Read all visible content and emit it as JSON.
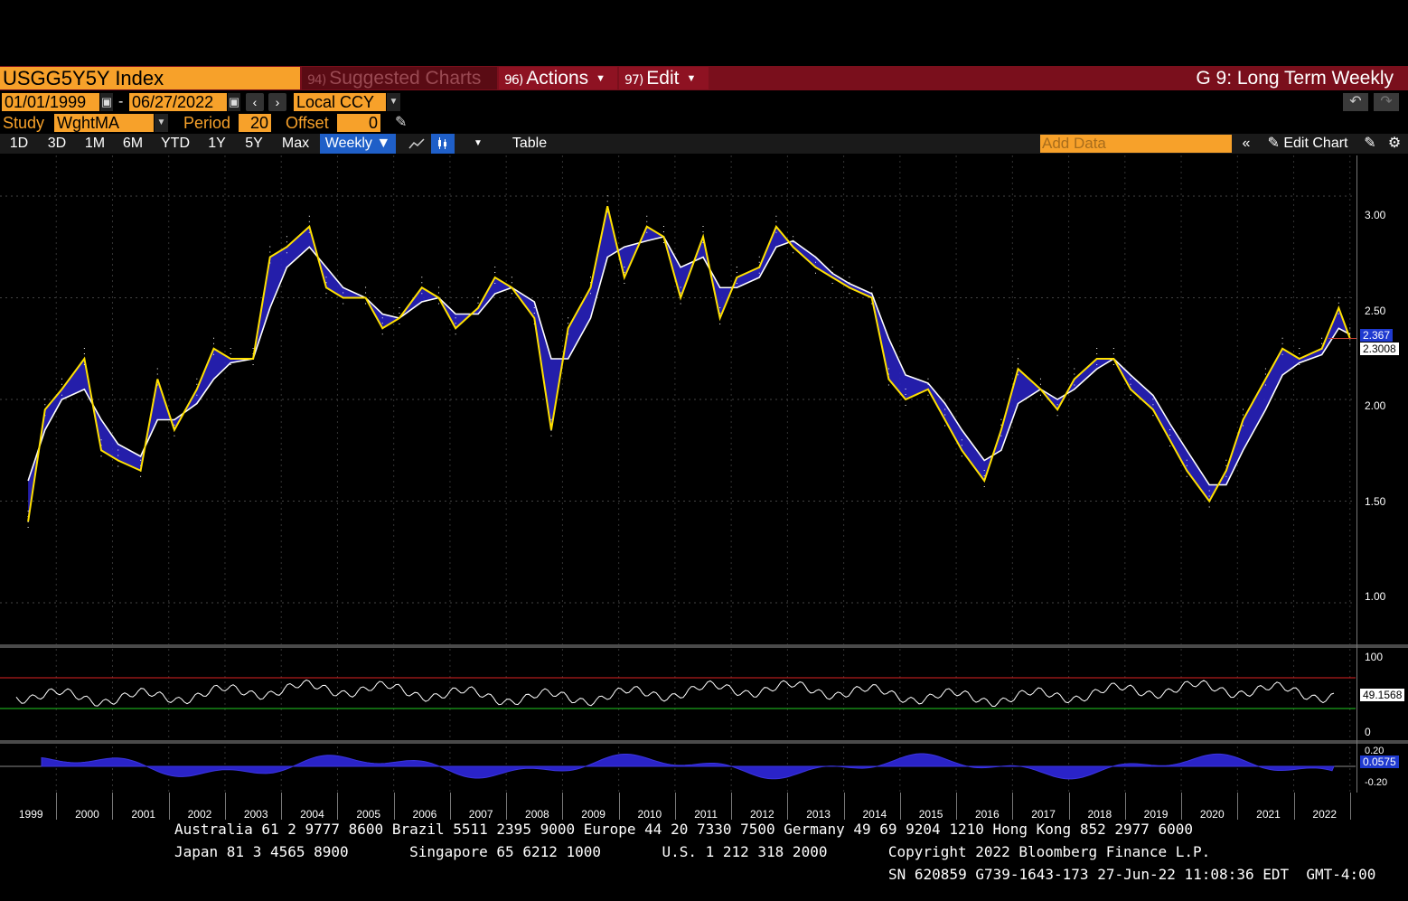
{
  "header": {
    "ticker": "USGG5Y5Y Index",
    "menus": [
      {
        "num": "94)",
        "label": "Suggested Charts"
      },
      {
        "num": "96)",
        "label": "Actions"
      },
      {
        "num": "97)",
        "label": "Edit"
      }
    ],
    "chart_title": "G 9: Long Term Weekly"
  },
  "range": {
    "start": "01/01/1999",
    "sep": "-",
    "end": "06/27/2022",
    "currency": "Local CCY"
  },
  "study": {
    "label": "Study",
    "value": "WghtMA",
    "period_label": "Period",
    "period": "20",
    "offset_label": "Offset",
    "offset": "0"
  },
  "toolbar": {
    "periods": [
      "1D",
      "3D",
      "1M",
      "6M",
      "YTD",
      "1Y",
      "5Y",
      "Max"
    ],
    "frequency": "Weekly ▼",
    "table": "Table",
    "add_data_placeholder": "Add Data",
    "edit_chart": "Edit Chart"
  },
  "main_axis": {
    "ticks": [
      "3.00",
      "2.50",
      "2.00",
      "1.50",
      "1.00"
    ],
    "last_price": "2.367",
    "ma_value": "2.3008"
  },
  "rsi_axis": {
    "ticks": [
      "100",
      "0"
    ],
    "value": "49.1568"
  },
  "macd_axis": {
    "ticks": [
      "0.20",
      "-0.20"
    ],
    "value": "0.0575"
  },
  "x_axis": [
    "1999",
    "2000",
    "2001",
    "2002",
    "2003",
    "2004",
    "2005",
    "2006",
    "2007",
    "2008",
    "2009",
    "2010",
    "2011",
    "2012",
    "2013",
    "2014",
    "2015",
    "2016",
    "2017",
    "2018",
    "2019",
    "2020",
    "2021",
    "2022"
  ],
  "footer": {
    "line1": "Australia 61 2 9777 8600 Brazil 5511 2395 9000 Europe 44 20 7330 7500 Germany 49 69 9204 1210 Hong Kong 852 2977 6000",
    "line2": "Japan 81 3 4565 8900       Singapore 65 6212 1000       U.S. 1 212 318 2000       Copyright 2022 Bloomberg Finance L.P.",
    "line3": "SN 620859 G739-1643-173 27-Jun-22 11:08:36 EDT  GMT-4:00"
  },
  "colors": {
    "orange": "#f7a12a",
    "ma_fast": "#ffe000",
    "ma_slow": "#ffffff",
    "fill": "#2a23c8",
    "bar_red": "#7a0f1c"
  },
  "chart_data": {
    "type": "line",
    "x": [
      1999.0,
      1999.3,
      1999.6,
      2000.0,
      2000.3,
      2000.6,
      2001.0,
      2001.3,
      2001.6,
      2002.0,
      2002.3,
      2002.6,
      2003.0,
      2003.3,
      2003.6,
      2004.0,
      2004.3,
      2004.6,
      2005.0,
      2005.3,
      2005.6,
      2006.0,
      2006.3,
      2006.6,
      2007.0,
      2007.3,
      2007.6,
      2008.0,
      2008.3,
      2008.6,
      2009.0,
      2009.3,
      2009.6,
      2010.0,
      2010.3,
      2010.6,
      2011.0,
      2011.3,
      2011.6,
      2012.0,
      2012.3,
      2012.6,
      2013.0,
      2013.3,
      2013.6,
      2014.0,
      2014.3,
      2014.6,
      2015.0,
      2015.3,
      2015.6,
      2016.0,
      2016.3,
      2016.6,
      2017.0,
      2017.3,
      2017.6,
      2018.0,
      2018.3,
      2018.6,
      2019.0,
      2019.3,
      2019.6,
      2020.0,
      2020.3,
      2020.6,
      2021.0,
      2021.3,
      2021.6,
      2022.0,
      2022.3,
      2022.5
    ],
    "series": [
      {
        "values": [
          1.4,
          1.95,
          2.05,
          2.2,
          1.75,
          1.7,
          1.65,
          2.1,
          1.85,
          2.05,
          2.25,
          2.2,
          2.2,
          2.7,
          2.75,
          2.85,
          2.55,
          2.5,
          2.5,
          2.35,
          2.4,
          2.55,
          2.5,
          2.35,
          2.45,
          2.6,
          2.55,
          2.4,
          1.85,
          2.35,
          2.55,
          2.95,
          2.6,
          2.85,
          2.8,
          2.5,
          2.8,
          2.4,
          2.6,
          2.65,
          2.85,
          2.75,
          2.65,
          2.6,
          2.55,
          2.5,
          2.1,
          2.0,
          2.05,
          1.9,
          1.75,
          1.6,
          1.85,
          2.15,
          2.05,
          1.95,
          2.1,
          2.2,
          2.2,
          2.05,
          1.95,
          1.8,
          1.65,
          1.5,
          1.65,
          1.9,
          2.1,
          2.25,
          2.2,
          2.25,
          2.45,
          2.3
        ]
      },
      {
        "values": [
          1.6,
          1.85,
          2.0,
          2.05,
          1.9,
          1.78,
          1.72,
          1.9,
          1.9,
          1.98,
          2.1,
          2.18,
          2.2,
          2.45,
          2.65,
          2.75,
          2.65,
          2.55,
          2.5,
          2.42,
          2.4,
          2.48,
          2.5,
          2.42,
          2.42,
          2.52,
          2.55,
          2.48,
          2.2,
          2.2,
          2.4,
          2.7,
          2.75,
          2.78,
          2.8,
          2.65,
          2.7,
          2.55,
          2.55,
          2.6,
          2.75,
          2.78,
          2.7,
          2.62,
          2.57,
          2.52,
          2.3,
          2.12,
          2.08,
          1.98,
          1.85,
          1.7,
          1.75,
          1.98,
          2.05,
          2.0,
          2.05,
          2.15,
          2.2,
          2.12,
          2.02,
          1.88,
          1.75,
          1.58,
          1.58,
          1.75,
          1.95,
          2.12,
          2.18,
          2.22,
          2.35,
          2.32
        ]
      }
    ],
    "ylim": [
      0.8,
      3.2
    ],
    "xlim": [
      1998.5,
      2022.6
    ],
    "grid": true
  }
}
